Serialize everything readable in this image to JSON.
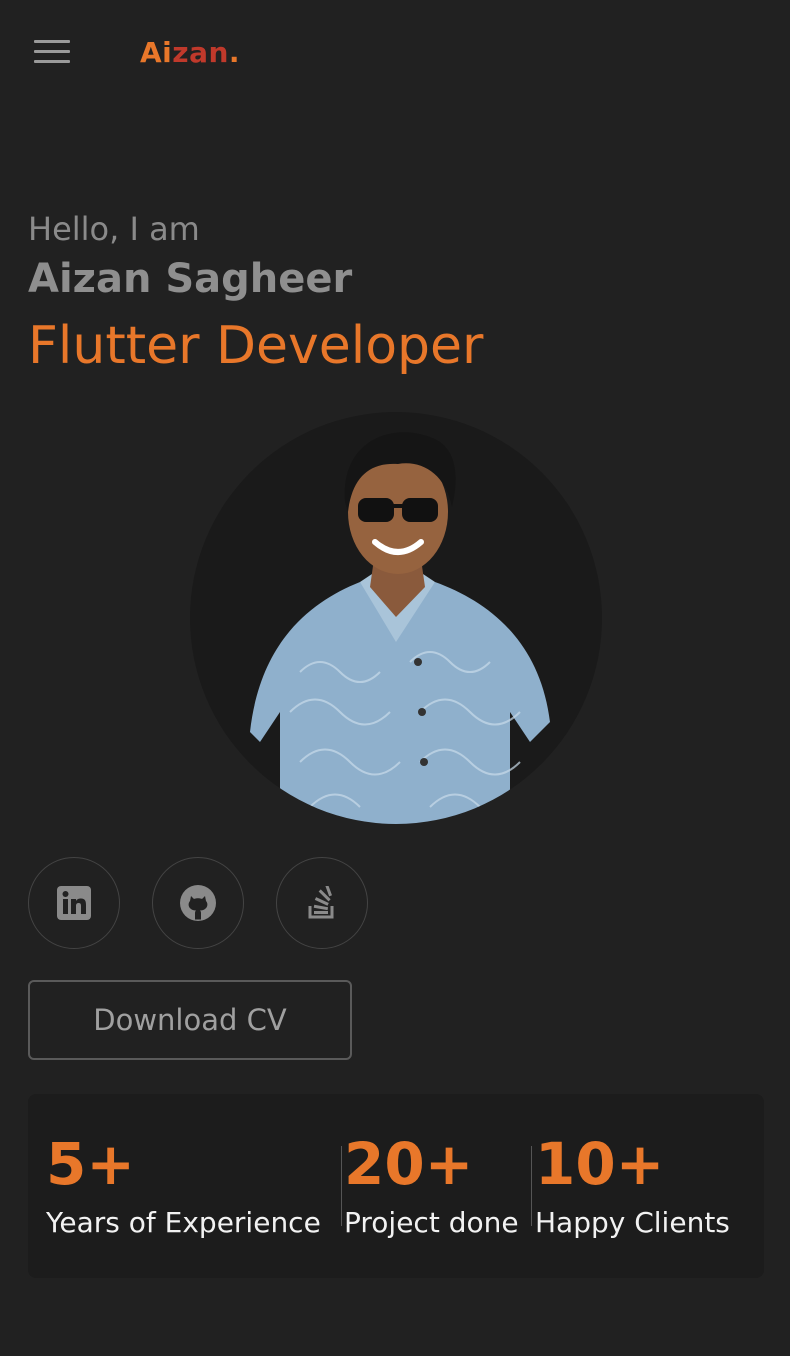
{
  "header": {
    "menu_icon": "hamburger-menu-icon",
    "logo_part1": "Ai",
    "logo_part2": "zan",
    "logo_part3": "."
  },
  "hero": {
    "greeting": "Hello, I am",
    "name": "Aizan Sagheer",
    "role": "Flutter Developer",
    "photo_alt": "Aizan Sagheer"
  },
  "socials": [
    {
      "icon": "linkedin-icon"
    },
    {
      "icon": "github-icon"
    },
    {
      "icon": "stackoverflow-icon"
    }
  ],
  "cv_button": "Download CV",
  "stats": [
    {
      "value": "5+",
      "label": "Years of Experience"
    },
    {
      "value": "20+",
      "label": "Project done"
    },
    {
      "value": "10+",
      "label": "Happy Clients"
    }
  ],
  "colors": {
    "background": "#212121",
    "accent": "#e8772a",
    "logo_mid": "#c0392b",
    "card": "#1c1c1c"
  }
}
